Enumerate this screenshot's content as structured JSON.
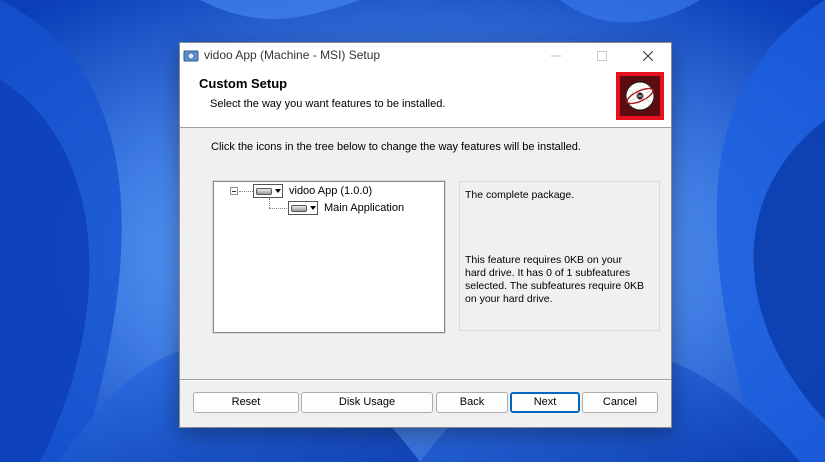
{
  "window": {
    "title": "vidoo App (Machine - MSI) Setup"
  },
  "banner": {
    "title": "Custom Setup",
    "subtitle": "Select the way you want features to be installed."
  },
  "instruction": "Click the icons in the tree below to change the way features will be installed.",
  "tree": {
    "items": [
      {
        "label": "vidoo App (1.0.0)"
      },
      {
        "label": "Main Application"
      }
    ]
  },
  "description": {
    "top": "The complete package.",
    "bottom": "This feature requires 0KB on your hard drive. It has 0 of 1 subfeatures selected. The subfeatures require 0KB on your hard drive."
  },
  "buttons": {
    "reset": "Reset",
    "disk_usage": "Disk Usage",
    "back": "Back",
    "next": "Next",
    "cancel": "Cancel"
  },
  "colors": {
    "accent": "#0067c0",
    "logo_red": "#e8101a",
    "desktop_blue": "#2a6bd8"
  }
}
